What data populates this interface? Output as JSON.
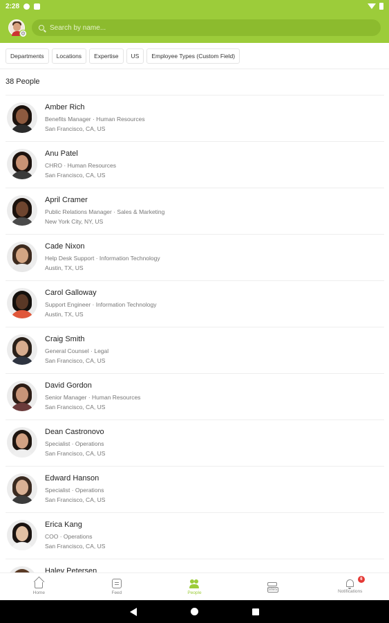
{
  "status_bar": {
    "time": "2:28"
  },
  "header": {
    "search_placeholder": "Search by name..."
  },
  "filters": [
    "Departments",
    "Locations",
    "Expertise",
    "US",
    "Employee Types (Custom Field)"
  ],
  "people_count": "38 People",
  "people": [
    {
      "name": "Amber Rich",
      "title": "Benefits Manager · Human Resources",
      "location": "San Francisco, CA, US",
      "skin": "#8d5a3f",
      "hair": "#1b120d",
      "shirt": "#2b2b2b"
    },
    {
      "name": "Anu Patel",
      "title": "CHRO · Human Resources",
      "location": "San Francisco, CA, US",
      "skin": "#c99375",
      "hair": "#1c120e",
      "shirt": "#3a3a3a"
    },
    {
      "name": "April Cramer",
      "title": "Public Relations Manager · Sales & Marketing",
      "location": "New York City, NY, US",
      "skin": "#6e452f",
      "hair": "#1a110c",
      "shirt": "#4a4a4a"
    },
    {
      "name": "Cade Nixon",
      "title": "Help Desk Support · Information Technology",
      "location": "Austin, TX, US",
      "skin": "#d3a583",
      "hair": "#3d2a1e",
      "shirt": "#e7e7e7"
    },
    {
      "name": "Carol Galloway",
      "title": "Support Engineer · Information Technology",
      "location": "Austin, TX, US",
      "skin": "#5a3826",
      "hair": "#14100d",
      "shirt": "#e0573a"
    },
    {
      "name": "Craig Smith",
      "title": "General Counsel · Legal",
      "location": "San Francisco, CA, US",
      "skin": "#d8ad8f",
      "hair": "#2a2019",
      "shirt": "#2e3440"
    },
    {
      "name": "David Gordon",
      "title": "Senior Manager · Human Resources",
      "location": "San Francisco, CA, US",
      "skin": "#c79478",
      "hair": "#2c1c15",
      "shirt": "#6a3a3a"
    },
    {
      "name": "Dean Castronovo",
      "title": "Specialist · Operations",
      "location": "San Francisco, CA, US",
      "skin": "#d2a183",
      "hair": "#1e1510",
      "shirt": "#efefef"
    },
    {
      "name": "Edward Hanson",
      "title": "Specialist · Operations",
      "location": "San Francisco, CA, US",
      "skin": "#d9b195",
      "hair": "#3a2a20",
      "shirt": "#3b3b3b"
    },
    {
      "name": "Erica Kang",
      "title": "COO · Operations",
      "location": "San Francisco, CA, US",
      "skin": "#e2c0a3",
      "hair": "#1a1310",
      "shirt": "#f4f4f4"
    },
    {
      "name": "Haley Petersen",
      "title": "",
      "location": "",
      "skin": "#dcb79c",
      "hair": "#5a3a25",
      "shirt": "#777777"
    }
  ],
  "bottom_nav": [
    {
      "label": "Home",
      "icon": "home-icon",
      "active": false
    },
    {
      "label": "Feed",
      "icon": "feed-icon",
      "active": false
    },
    {
      "label": "People",
      "icon": "people-icon",
      "active": true
    },
    {
      "label": "Sites",
      "icon": "sites-icon",
      "active": false
    },
    {
      "label": "Notifications",
      "icon": "bell-icon",
      "active": false,
      "badge": "6"
    }
  ],
  "colors": {
    "accent": "#9ccc3a",
    "search_bg": "#8cbb2e",
    "badge": "#e53935"
  }
}
